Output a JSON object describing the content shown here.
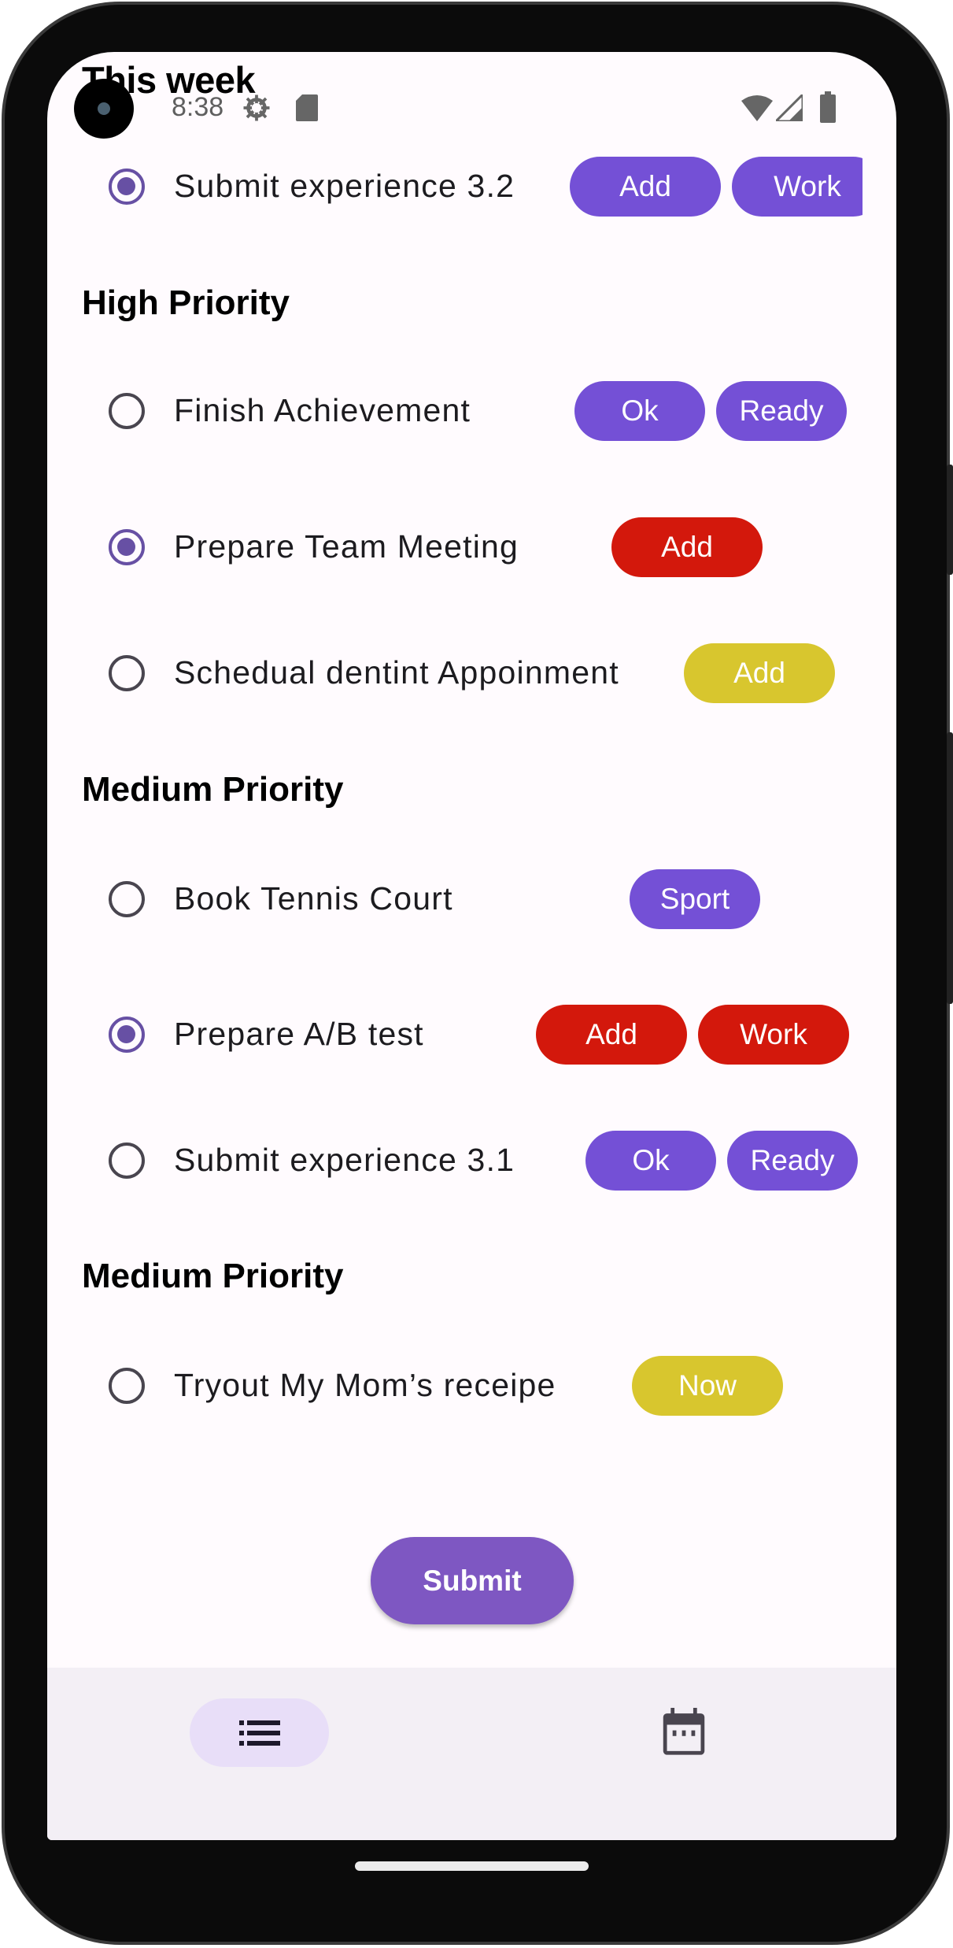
{
  "status_bar": {
    "time": "8:38",
    "icons": [
      "settings-icon",
      "sd-card-icon",
      "wifi-icon",
      "signal-icon",
      "battery-icon"
    ]
  },
  "header": {
    "title": "This week"
  },
  "colors": {
    "chip_purple": "#7450D6",
    "chip_red": "#D3180C",
    "chip_yellow": "#D8C62E",
    "accent": "#6750A4",
    "submit": "#7E57C2",
    "nav_bg": "#F3EFF5",
    "nav_active": "#E8DEF8"
  },
  "sections": [
    {
      "title": "",
      "tasks": [
        {
          "label": "Submit experience 3.2",
          "selected": true,
          "chips": [
            {
              "label": "Add",
              "color": "purple"
            },
            {
              "label": "Work",
              "color": "purple"
            }
          ]
        }
      ]
    },
    {
      "title": "High Priority",
      "tasks": [
        {
          "label": "Finish Achievement",
          "selected": false,
          "chips": [
            {
              "label": "Ok",
              "color": "purple"
            },
            {
              "label": "Ready",
              "color": "purple"
            }
          ]
        },
        {
          "label": "Prepare Team Meeting",
          "selected": true,
          "chips": [
            {
              "label": "Add",
              "color": "red"
            }
          ]
        },
        {
          "label": "Schedual dentint Appoinment",
          "selected": false,
          "chips": [
            {
              "label": "Add",
              "color": "yellow"
            }
          ]
        }
      ]
    },
    {
      "title": "Medium Priority",
      "tasks": [
        {
          "label": "Book Tennis Court",
          "selected": false,
          "chips": [
            {
              "label": "Sport",
              "color": "purple"
            }
          ]
        },
        {
          "label": "Prepare A/B test",
          "selected": true,
          "chips": [
            {
              "label": "Add",
              "color": "red"
            },
            {
              "label": "Work",
              "color": "red"
            }
          ]
        },
        {
          "label": "Submit experience 3.1",
          "selected": false,
          "chips": [
            {
              "label": "Ok",
              "color": "purple"
            },
            {
              "label": "Ready",
              "color": "purple"
            }
          ]
        }
      ]
    },
    {
      "title": "Medium Priority",
      "tasks": [
        {
          "label": "Tryout My Mom’s receipe",
          "selected": false,
          "chips": [
            {
              "label": "Now",
              "color": "yellow"
            }
          ]
        }
      ]
    }
  ],
  "submit_label": "Submit",
  "bottom_nav": {
    "items": [
      {
        "icon": "list-icon",
        "active": true
      },
      {
        "icon": "calendar-icon",
        "active": false
      }
    ]
  }
}
